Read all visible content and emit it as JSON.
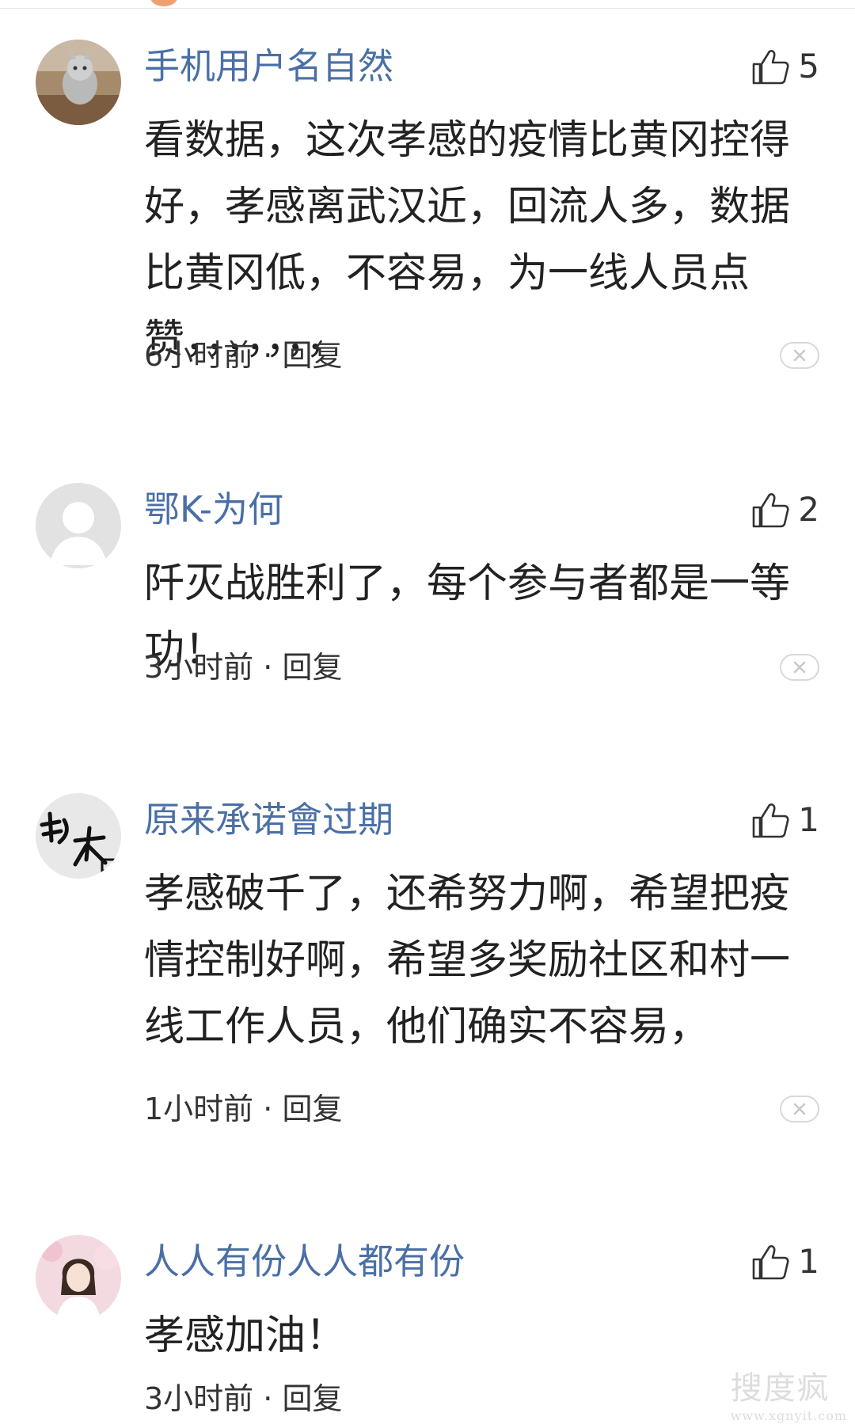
{
  "comments": [
    {
      "username": "手机用户名自然",
      "likes": "5",
      "content": "看数据，这次孝感的疫情比黄冈控得好，孝感离武汉近，回流人多，数据比黄冈低，不容易，为一线人员点赞，，，，，，，",
      "time": "6小时前",
      "reply": "回复",
      "avatar": "cat-photo"
    },
    {
      "username": "鄂K-为何",
      "likes": "2",
      "content": "阡灭战胜利了，每个参与者都是一等功！",
      "time": "3小时前",
      "reply": "回复",
      "avatar": "default-person"
    },
    {
      "username": "原来承诺會过期",
      "likes": "1",
      "content": "孝感破千了，还希努力啊，希望把疫情控制好啊，希望多奖励社区和村一线工作人员，他们确实不容易，",
      "time": "1小时前",
      "reply": "回复",
      "avatar": "calligraphy"
    },
    {
      "username": "人人有份人人都有份",
      "likes": "1",
      "content": "孝感加油！",
      "time": "3小时前",
      "reply": "回复",
      "avatar": "girl-photo"
    }
  ],
  "separator": " · ",
  "watermark": {
    "main": "搜度疯",
    "sub": "www.xgnyit.com"
  },
  "colors": {
    "username": "#4a6fa5",
    "text": "#222222",
    "meta": "#333333",
    "border": "#d8d8d8"
  },
  "icons": [
    "thumbs-up-icon",
    "close-icon"
  ]
}
